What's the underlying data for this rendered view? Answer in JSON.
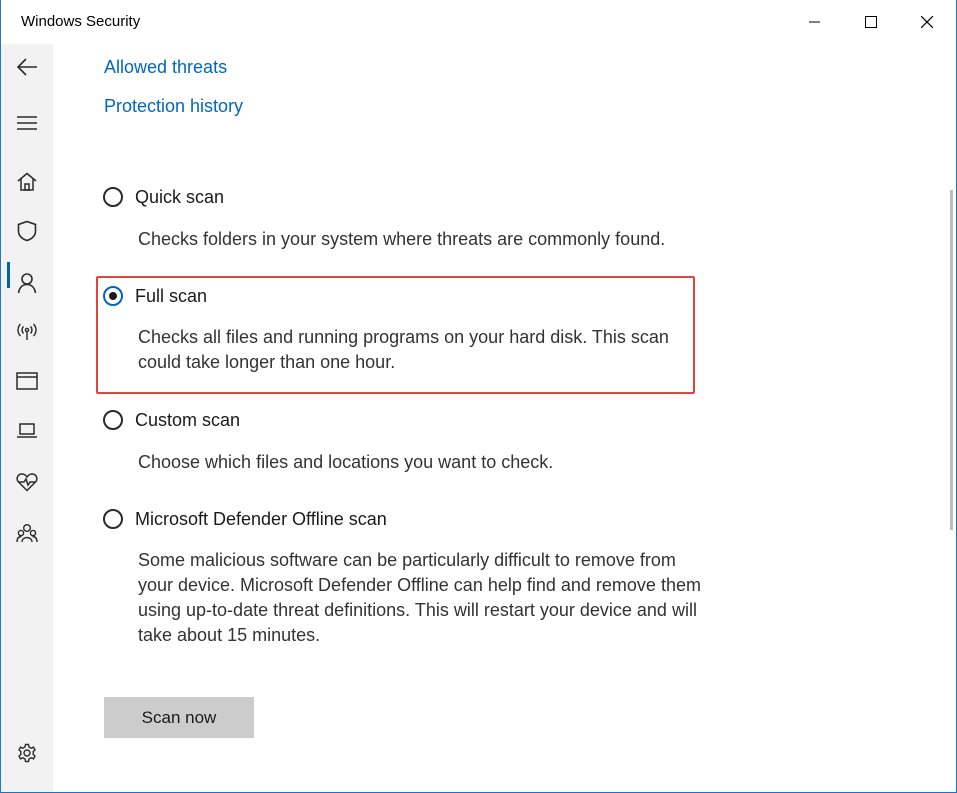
{
  "window": {
    "title": "Windows Security"
  },
  "links": {
    "allowed_threats": "Allowed threats",
    "protection_history": "Protection history"
  },
  "options": [
    {
      "label": "Quick scan",
      "description": "Checks folders in your system where threats are commonly found.",
      "selected": false
    },
    {
      "label": "Full scan",
      "description": "Checks all files and running programs on your hard disk. This scan could take longer than one hour.",
      "selected": true
    },
    {
      "label": "Custom scan",
      "description": "Choose which files and locations you want to check.",
      "selected": false
    },
    {
      "label": "Microsoft Defender Offline scan",
      "description": "Some malicious software can be particularly difficult to remove from your device. Microsoft Defender Offline can help find and remove them using up-to-date threat definitions. This will restart your device and will take about 15 minutes.",
      "selected": false
    }
  ],
  "scan_button": {
    "label": "Scan now"
  },
  "sidebar": {
    "icons": [
      "back-arrow-icon",
      "menu-icon",
      "home-icon",
      "shield-icon",
      "account-icon",
      "firewall-network-icon",
      "app-browser-control-icon",
      "device-security-icon",
      "device-health-icon",
      "family-options-icon",
      "settings-icon"
    ],
    "active": "shield-icon"
  },
  "colors": {
    "accent": "#0067c0",
    "highlight_border": "#e0463b",
    "sidebar_bg": "#f2f2f2",
    "button_bg": "#cccccc"
  }
}
